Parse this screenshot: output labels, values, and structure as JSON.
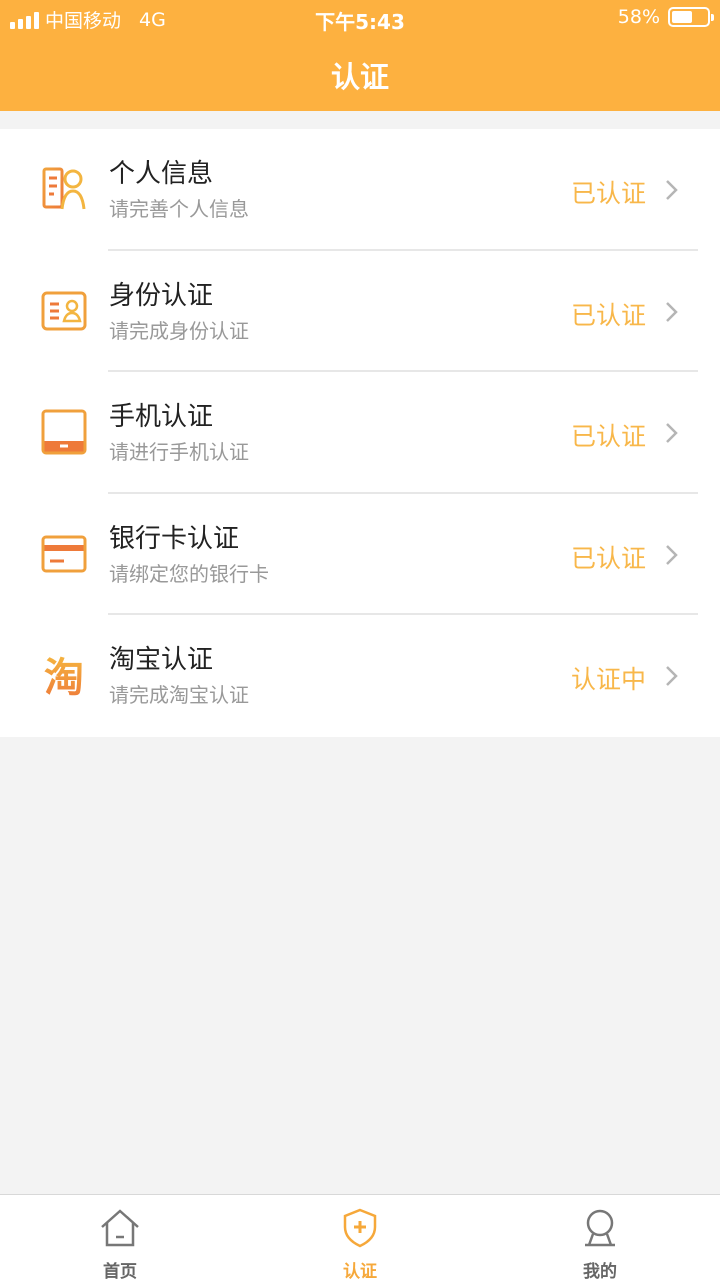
{
  "status_bar": {
    "carrier": "中国移动",
    "network": "4G",
    "time": "下午5:43",
    "battery": "58%"
  },
  "header": {
    "title": "认证"
  },
  "items": [
    {
      "name": "个人信息",
      "desc": "请完善个人信息",
      "state": "已认证",
      "icon": "person-info-icon"
    },
    {
      "name": "身份认证",
      "desc": "请完成身份认证",
      "state": "已认证",
      "icon": "id-card-icon"
    },
    {
      "name": "手机认证",
      "desc": "请进行手机认证",
      "state": "已认证",
      "icon": "tablet-icon"
    },
    {
      "name": "银行卡认证",
      "desc": "请绑定您的银行卡",
      "state": "已认证",
      "icon": "bank-card-icon"
    },
    {
      "name": "淘宝认证",
      "desc": "请完成淘宝认证",
      "state": "认证中",
      "icon": "taobao-icon",
      "icon_text": "淘"
    }
  ],
  "tabbar": {
    "home": {
      "label": "首页",
      "icon": "home-icon"
    },
    "verify": {
      "label": "认证",
      "icon": "shield-icon"
    },
    "me": {
      "label": "我的",
      "icon": "user-icon"
    }
  },
  "colors": {
    "accent": "#fdb140",
    "state_text": "#f8b74a",
    "icon_orange": "#f07e3a"
  }
}
